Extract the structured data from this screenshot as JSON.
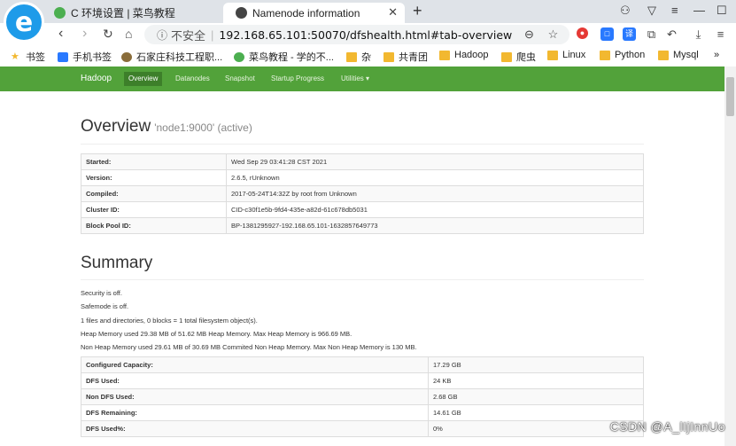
{
  "browser": {
    "tabs": [
      {
        "title": "C 环境设置 | 菜鸟教程",
        "favicon_color": "#4caf50"
      },
      {
        "title": "Namenode information",
        "favicon_color": "#444444"
      }
    ],
    "security_label": "不安全",
    "url": "192.168.65.101:50070/dfshealth.html#tab-overview",
    "bookmarks": [
      "书签",
      "手机书签",
      "石家庄科技工程职...",
      "菜鸟教程 - 学的不...",
      "杂",
      "共青团",
      "Hadoop",
      "爬虫",
      "Linux",
      "Python",
      "Mysql"
    ],
    "bookmarks_more": "»"
  },
  "navbar": {
    "brand": "Hadoop",
    "items": [
      "Overview",
      "Datanodes",
      "Snapshot",
      "Startup Progress",
      "Utilities ▾"
    ],
    "active_color": "#3d7f2a",
    "bar_color": "#52a23a"
  },
  "overview": {
    "title": "Overview",
    "subtitle": "'node1:9000' (active)",
    "rows": [
      {
        "key": "Started:",
        "value": "Wed Sep 29 03:41:28 CST 2021"
      },
      {
        "key": "Version:",
        "value": "2.6.5, rUnknown"
      },
      {
        "key": "Compiled:",
        "value": "2017-05-24T14:32Z by root from Unknown"
      },
      {
        "key": "Cluster ID:",
        "value": "CID-c30f1e5b-9fd4-435e-a82d-61c678db5031"
      },
      {
        "key": "Block Pool ID:",
        "value": "BP-1381295927-192.168.65.101-1632857649773"
      }
    ]
  },
  "summary": {
    "title": "Summary",
    "lines": [
      "Security is off.",
      "Safemode is off.",
      "1 files and directories, 0 blocks = 1 total filesystem object(s).",
      "Heap Memory used 29.38 MB of 51.62 MB Heap Memory. Max Heap Memory is 966.69 MB.",
      "Non Heap Memory used 29.61 MB of 30.69 MB Commited Non Heap Memory. Max Non Heap Memory is 130 MB."
    ],
    "rows": [
      {
        "key": "Configured Capacity:",
        "value": "17.29 GB"
      },
      {
        "key": "DFS Used:",
        "value": "24 KB"
      },
      {
        "key": "Non DFS Used:",
        "value": "2.68 GB"
      },
      {
        "key": "DFS Remaining:",
        "value": "14.61 GB"
      },
      {
        "key": "DFS Used%:",
        "value": "0%"
      }
    ]
  },
  "watermark": "CSDN @A_lIjInnUo"
}
